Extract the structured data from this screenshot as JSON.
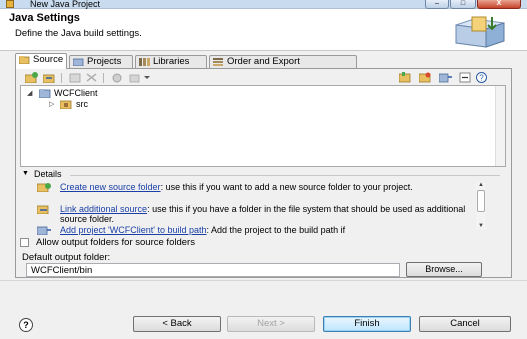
{
  "window": {
    "title": "New Java Project",
    "minimize_label": "–",
    "maximize_label": "□",
    "close_label": "X"
  },
  "header": {
    "title": "Java Settings",
    "description": "Define the Java build settings."
  },
  "tabs": [
    {
      "label": "Source",
      "active": true
    },
    {
      "label": "Projects",
      "active": false
    },
    {
      "label": "Libraries",
      "active": false
    },
    {
      "label": "Order and Export",
      "active": false
    }
  ],
  "tree": {
    "project": "WCFClient",
    "folder": "src"
  },
  "details": {
    "label": "Details",
    "items": [
      {
        "link": "Create new source folder",
        "text": ": use this if you want to add a new source folder to your project."
      },
      {
        "link": "Link additional source",
        "text": ": use this if you have a folder in the file system that should be used as additional source folder."
      },
      {
        "link": "Add project 'WCFClient' to build path",
        "text": ": Add the project to the build path if"
      }
    ]
  },
  "output": {
    "checkbox_label": "Allow output folders for source folders",
    "checked": false,
    "folder_label": "Default output folder:",
    "folder_value": "WCFClient/bin",
    "browse_label": "Browse..."
  },
  "buttons": {
    "help": "?",
    "back": "< Back",
    "next": "Next >",
    "finish": "Finish",
    "cancel": "Cancel"
  }
}
